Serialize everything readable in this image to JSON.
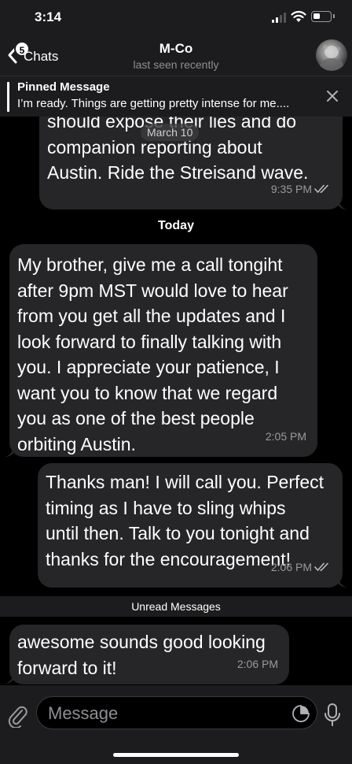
{
  "status_bar": {
    "time": "3:14"
  },
  "header": {
    "back_badge": "5",
    "back_label": "Chats",
    "title": "M-Co",
    "subtitle": "last seen recently"
  },
  "pinned": {
    "title": "Pinned Message",
    "text": "I’m ready. Things are getting pretty intense for me...."
  },
  "messages": [
    {
      "direction": "outgoing",
      "text": "should expose their lies and do\ncompanion reporting about\nAustin. Ride the Streisand wave.",
      "time": "9:35 PM",
      "read": true
    },
    {
      "direction": "incoming",
      "text": "My brother, give me a call tongiht\nafter 9pm  MST would love to hear\nfrom you get all the updates and I\nlook forward to finally talking with\nyou. I appreciate your patience, I\nwant you to know that we regard\nyou as one of the best people\norbiting Austin.",
      "time": "2:05 PM"
    },
    {
      "direction": "outgoing",
      "text": "Thanks man! I will call you. Perfect\ntiming as I have to sling whips\nuntil then. Talk to you tonight and\nthanks for the encouragement!",
      "time": "2:06 PM",
      "read": true
    },
    {
      "direction": "incoming",
      "text": "awesome sounds good looking\nforward to it!",
      "time": "2:06 PM"
    }
  ],
  "floating_date": "March 10",
  "date_separator": "Today",
  "unread_label": "Unread Messages",
  "input": {
    "placeholder": "Message"
  },
  "icons": {
    "back": "chevron-left-icon",
    "close": "close-icon",
    "attach": "paperclip-icon",
    "sticker": "sticker-icon",
    "mic": "microphone-icon",
    "read": "double-check-icon"
  },
  "colors": {
    "background": "#000000",
    "bar": "#1c1c1e",
    "bubble": "#262628",
    "meta": "#9a9a9f"
  }
}
